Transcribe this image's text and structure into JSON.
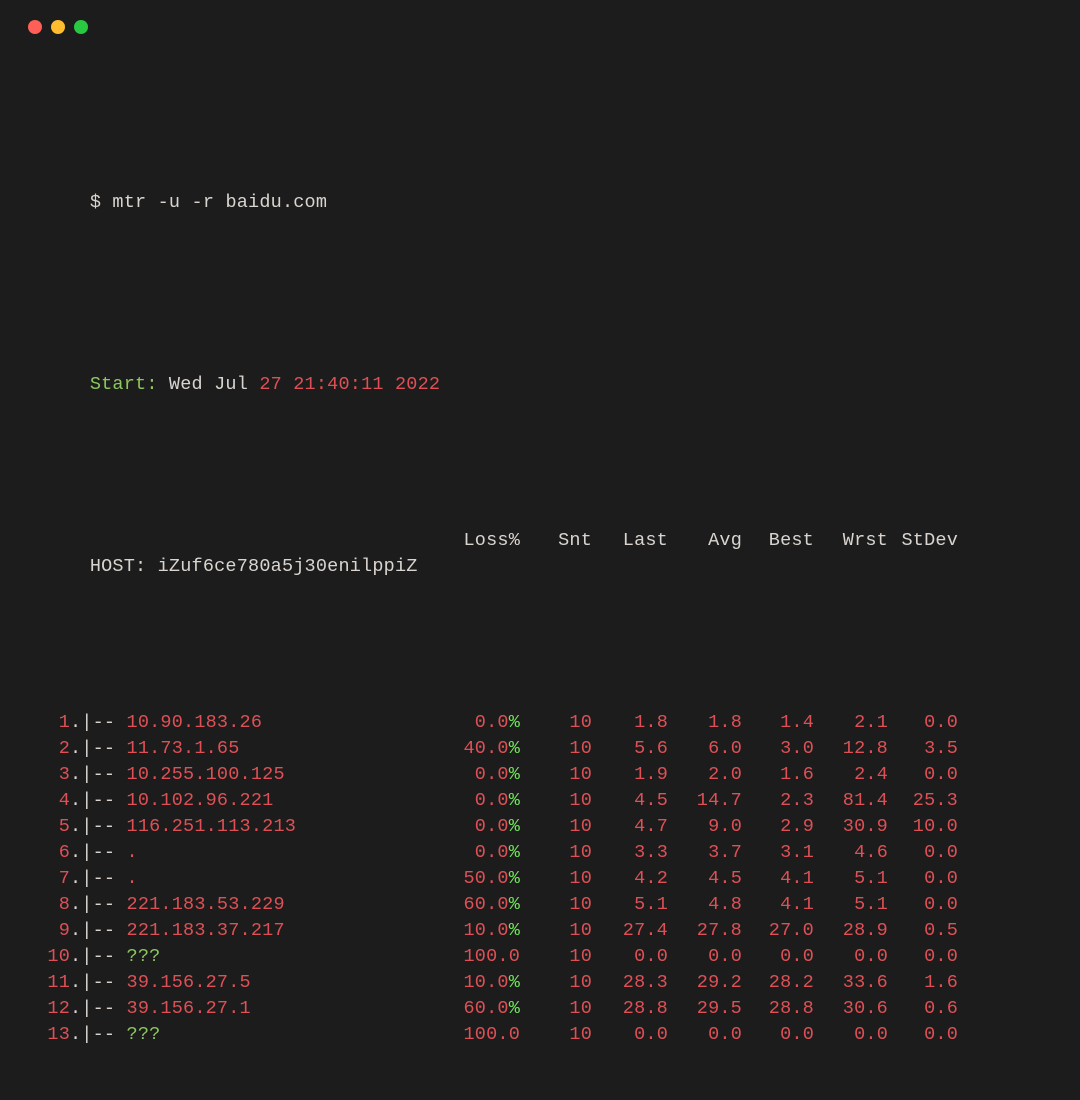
{
  "prompt_prefix": "$ ",
  "command": "mtr -u -r baidu.com",
  "start": {
    "label": "Start:",
    "day": " Wed Jul",
    "date": " 27 21:40:11 2022"
  },
  "host": {
    "label": "HOST: ",
    "name": "iZuf6ce780a5j30enilppiZ"
  },
  "headers": {
    "loss": "Loss%",
    "snt": "Snt",
    "last": "Last",
    "avg": "Avg",
    "best": "Best",
    "wrst": "Wrst",
    "stdev": "StDev"
  },
  "pct": "%",
  "hops": [
    {
      "num": "1",
      "addr": "10.90.183.26",
      "unknown": false,
      "loss": "0.0",
      "loss_pct": true,
      "snt": "10",
      "last": "1.8",
      "avg": "1.8",
      "best": "1.4",
      "wrst": "2.1",
      "stdev": "0.0"
    },
    {
      "num": "2",
      "addr": "11.73.1.65",
      "unknown": false,
      "loss": "40.0",
      "loss_pct": true,
      "snt": "10",
      "last": "5.6",
      "avg": "6.0",
      "best": "3.0",
      "wrst": "12.8",
      "stdev": "3.5"
    },
    {
      "num": "3",
      "addr": "10.255.100.125",
      "unknown": false,
      "loss": "0.0",
      "loss_pct": true,
      "snt": "10",
      "last": "1.9",
      "avg": "2.0",
      "best": "1.6",
      "wrst": "2.4",
      "stdev": "0.0"
    },
    {
      "num": "4",
      "addr": "10.102.96.221",
      "unknown": false,
      "loss": "0.0",
      "loss_pct": true,
      "snt": "10",
      "last": "4.5",
      "avg": "14.7",
      "best": "2.3",
      "wrst": "81.4",
      "stdev": "25.3"
    },
    {
      "num": "5",
      "addr": "116.251.113.213",
      "unknown": false,
      "loss": "0.0",
      "loss_pct": true,
      "snt": "10",
      "last": "4.7",
      "avg": "9.0",
      "best": "2.9",
      "wrst": "30.9",
      "stdev": "10.0"
    },
    {
      "num": "6",
      "addr": ".",
      "unknown": false,
      "loss": "0.0",
      "loss_pct": true,
      "snt": "10",
      "last": "3.3",
      "avg": "3.7",
      "best": "3.1",
      "wrst": "4.6",
      "stdev": "0.0"
    },
    {
      "num": "7",
      "addr": ".",
      "unknown": false,
      "loss": "50.0",
      "loss_pct": true,
      "snt": "10",
      "last": "4.2",
      "avg": "4.5",
      "best": "4.1",
      "wrst": "5.1",
      "stdev": "0.0"
    },
    {
      "num": "8",
      "addr": "221.183.53.229",
      "unknown": false,
      "loss": "60.0",
      "loss_pct": true,
      "snt": "10",
      "last": "5.1",
      "avg": "4.8",
      "best": "4.1",
      "wrst": "5.1",
      "stdev": "0.0"
    },
    {
      "num": "9",
      "addr": "221.183.37.217",
      "unknown": false,
      "loss": "10.0",
      "loss_pct": true,
      "snt": "10",
      "last": "27.4",
      "avg": "27.8",
      "best": "27.0",
      "wrst": "28.9",
      "stdev": "0.5"
    },
    {
      "num": "10",
      "addr": "???",
      "unknown": true,
      "loss": "100.0",
      "loss_pct": false,
      "snt": "10",
      "last": "0.0",
      "avg": "0.0",
      "best": "0.0",
      "wrst": "0.0",
      "stdev": "0.0"
    },
    {
      "num": "11",
      "addr": "39.156.27.5",
      "unknown": false,
      "loss": "10.0",
      "loss_pct": true,
      "snt": "10",
      "last": "28.3",
      "avg": "29.2",
      "best": "28.2",
      "wrst": "33.6",
      "stdev": "1.6"
    },
    {
      "num": "12",
      "addr": "39.156.27.1",
      "unknown": false,
      "loss": "60.0",
      "loss_pct": true,
      "snt": "10",
      "last": "28.8",
      "avg": "29.5",
      "best": "28.8",
      "wrst": "30.6",
      "stdev": "0.6"
    },
    {
      "num": "13",
      "addr": "???",
      "unknown": true,
      "loss": "100.0",
      "loss_pct": false,
      "snt": "10",
      "last": "0.0",
      "avg": "0.0",
      "best": "0.0",
      "wrst": "0.0",
      "stdev": "0.0"
    }
  ]
}
